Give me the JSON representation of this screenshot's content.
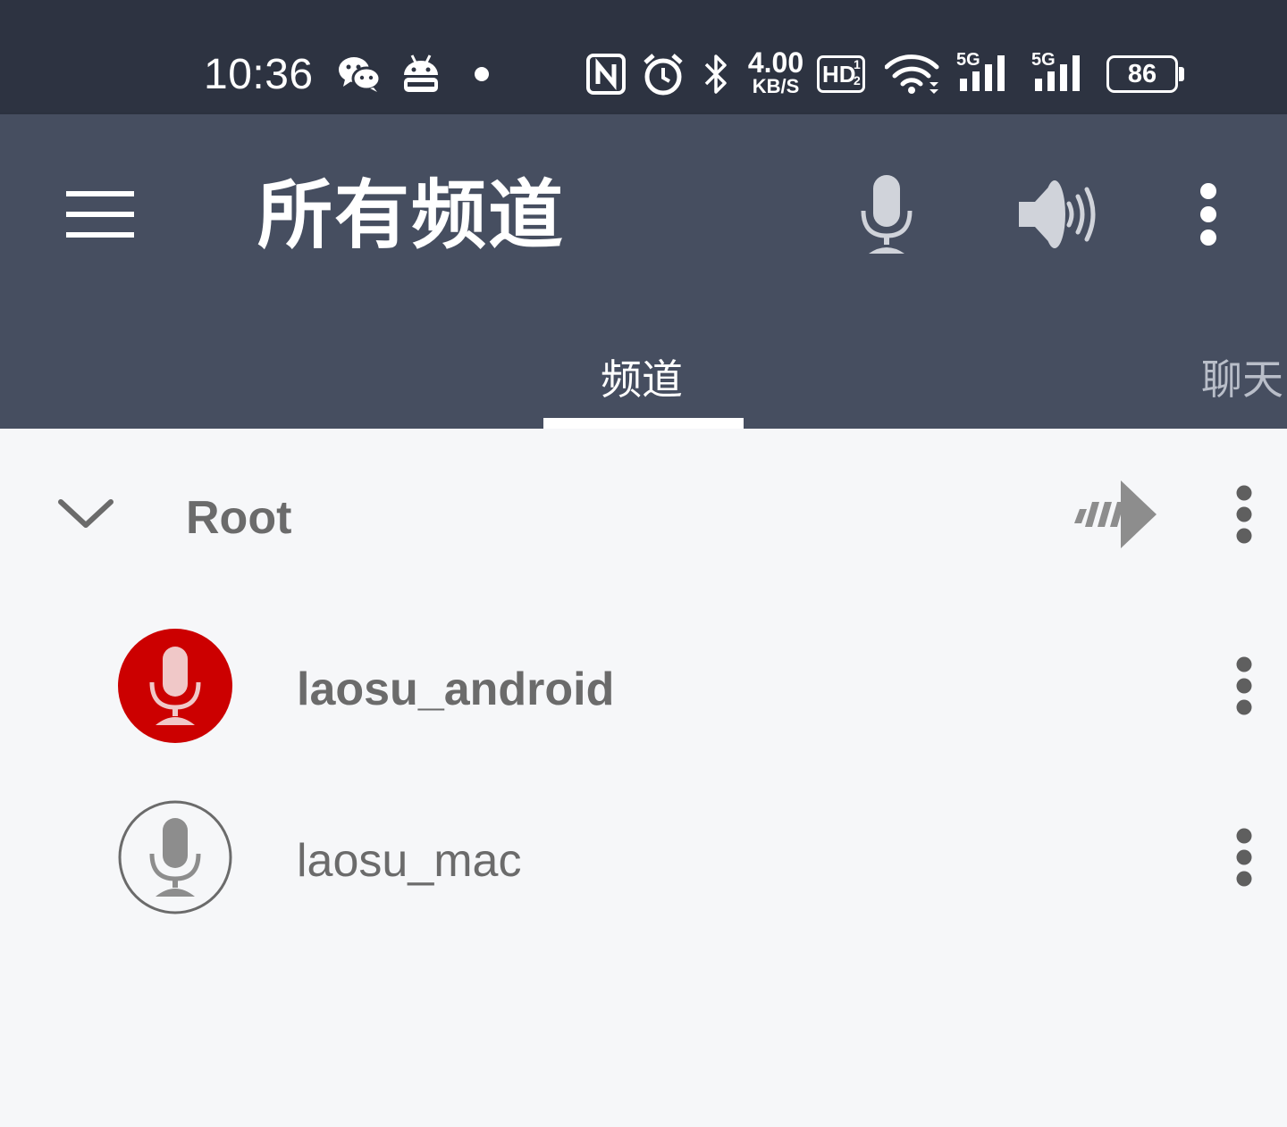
{
  "status_bar": {
    "time": "10:36",
    "notification_icons": [
      "wechat-icon",
      "android-bot-icon",
      "dot-icon"
    ],
    "system_icons": [
      "nfc-icon",
      "alarm-icon",
      "bluetooth-icon",
      "net-speed",
      "hd-icon",
      "wifi-icon",
      "signal-5g-icon",
      "signal-5g-icon",
      "battery-icon"
    ],
    "net_speed_value": "4.00",
    "net_speed_unit": "KB/S",
    "hd_label": "HD",
    "hd_sub_1": "1",
    "hd_sub_2": "2",
    "signal_1_label": "5G",
    "signal_2_label": "5G",
    "battery_level": "86"
  },
  "app_bar": {
    "title": "所有频道",
    "icons": [
      "menu-icon",
      "microphone-icon",
      "speaker-icon",
      "more-vert-icon"
    ]
  },
  "tabs": [
    {
      "label": "频道",
      "active": true
    },
    {
      "label": "聊天",
      "active": false
    }
  ],
  "channel": {
    "name": "Root",
    "expanded": true
  },
  "users": [
    {
      "name": "laosu_android",
      "talking": true
    },
    {
      "name": "laosu_mac",
      "talking": false
    }
  ],
  "colors": {
    "status_bar_bg": "#2d3341",
    "app_bar_bg": "#464e60",
    "content_bg": "#f6f7f9",
    "talking_red": "#cc0000",
    "text_gray": "#6b6b6b"
  }
}
